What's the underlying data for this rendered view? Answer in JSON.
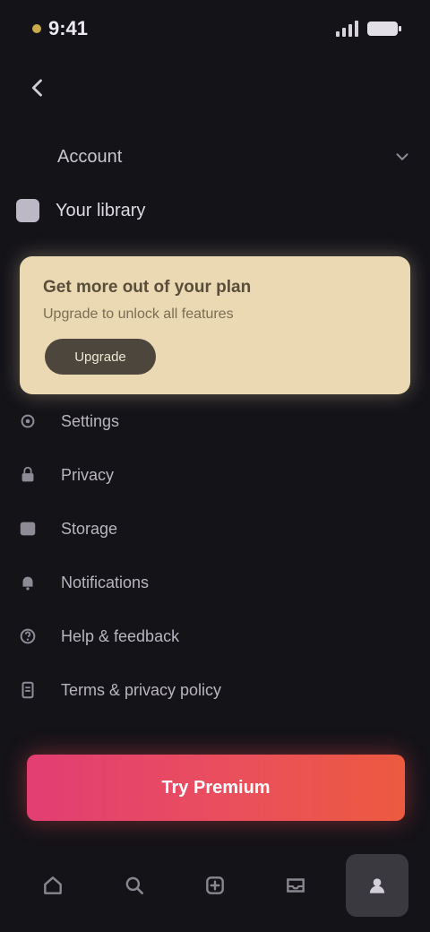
{
  "status_bar": {
    "time": "9:41"
  },
  "header": {
    "account_name": "Account"
  },
  "current": {
    "label": "Your library"
  },
  "promo": {
    "title": "Get more out of your plan",
    "subtitle": "Upgrade to unlock all features",
    "button_label": "Upgrade"
  },
  "menu": {
    "items": [
      {
        "label": "Settings",
        "icon": "gear-icon"
      },
      {
        "label": "Privacy",
        "icon": "lock-icon"
      },
      {
        "label": "Storage",
        "icon": "box-icon"
      },
      {
        "label": "Notifications",
        "icon": "bell-icon"
      },
      {
        "label": "Help & feedback",
        "icon": "help-icon"
      },
      {
        "label": "Terms & privacy policy",
        "icon": "doc-icon"
      }
    ]
  },
  "cta": {
    "label": "Try Premium"
  },
  "bottom_nav": {
    "tabs": [
      {
        "name": "home-icon"
      },
      {
        "name": "search-icon"
      },
      {
        "name": "add-icon"
      },
      {
        "name": "inbox-icon"
      },
      {
        "name": "profile-icon"
      }
    ],
    "active_index": 4
  },
  "colors": {
    "background": "#141318",
    "promo": "#ead9b3",
    "cta_start": "#e23e73",
    "cta_end": "#ec5a3f"
  }
}
